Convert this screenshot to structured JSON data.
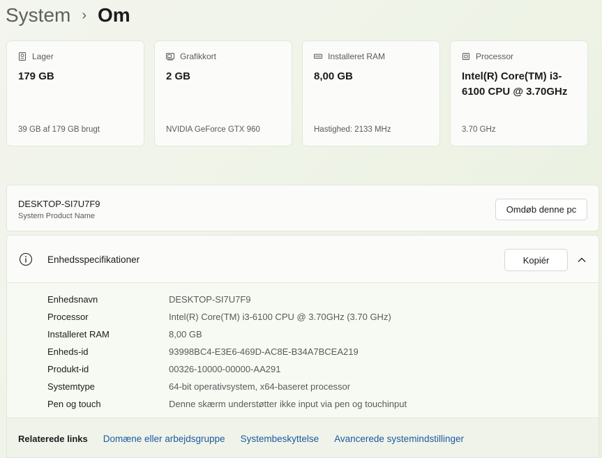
{
  "breadcrumb": {
    "parent": "System",
    "separator": "›",
    "current": "Om"
  },
  "cards": [
    {
      "label": "Lager",
      "icon": "hard-drive-icon",
      "value": "179 GB",
      "sub": "39 GB af 179 GB brugt"
    },
    {
      "label": "Grafikkort",
      "icon": "graphics-card-icon",
      "value": "2 GB",
      "sub": "NVIDIA GeForce GTX 960"
    },
    {
      "label": "Installeret RAM",
      "icon": "ram-icon",
      "value": "8,00 GB",
      "sub": "Hastighed: 2133 MHz"
    },
    {
      "label": "Processor",
      "icon": "processor-icon",
      "value": "Intel(R) Core(TM) i3-6100 CPU @ 3.70GHz",
      "sub": "3.70 GHz"
    }
  ],
  "pc": {
    "name": "DESKTOP-SI7U7F9",
    "sub": "System Product Name",
    "rename_label": "Omdøb denne pc"
  },
  "specs": {
    "title": "Enhedsspecifikationer",
    "copy_label": "Kopiér",
    "rows": [
      {
        "key": "Enhedsnavn",
        "value": "DESKTOP-SI7U7F9"
      },
      {
        "key": "Processor",
        "value": "Intel(R) Core(TM) i3-6100 CPU @ 3.70GHz (3.70 GHz)"
      },
      {
        "key": "Installeret RAM",
        "value": "8,00 GB"
      },
      {
        "key": "Enheds-id",
        "value": "93998BC4-E3E6-469D-AC8E-B34A7BCEA219"
      },
      {
        "key": "Produkt-id",
        "value": "00326-10000-00000-AA291"
      },
      {
        "key": "Systemtype",
        "value": "64-bit operativsystem, x64-baseret processor"
      },
      {
        "key": "Pen og touch",
        "value": "Denne skærm understøtter ikke input via pen og touchinput"
      }
    ]
  },
  "related": {
    "label": "Relaterede links",
    "links": [
      "Domæne eller arbejdsgruppe",
      "Systembeskyttelse",
      "Avancerede systemindstillinger"
    ]
  },
  "colors": {
    "link": "#1a5a9e",
    "background": "#eef3e6",
    "card": "#fbfcf9"
  }
}
